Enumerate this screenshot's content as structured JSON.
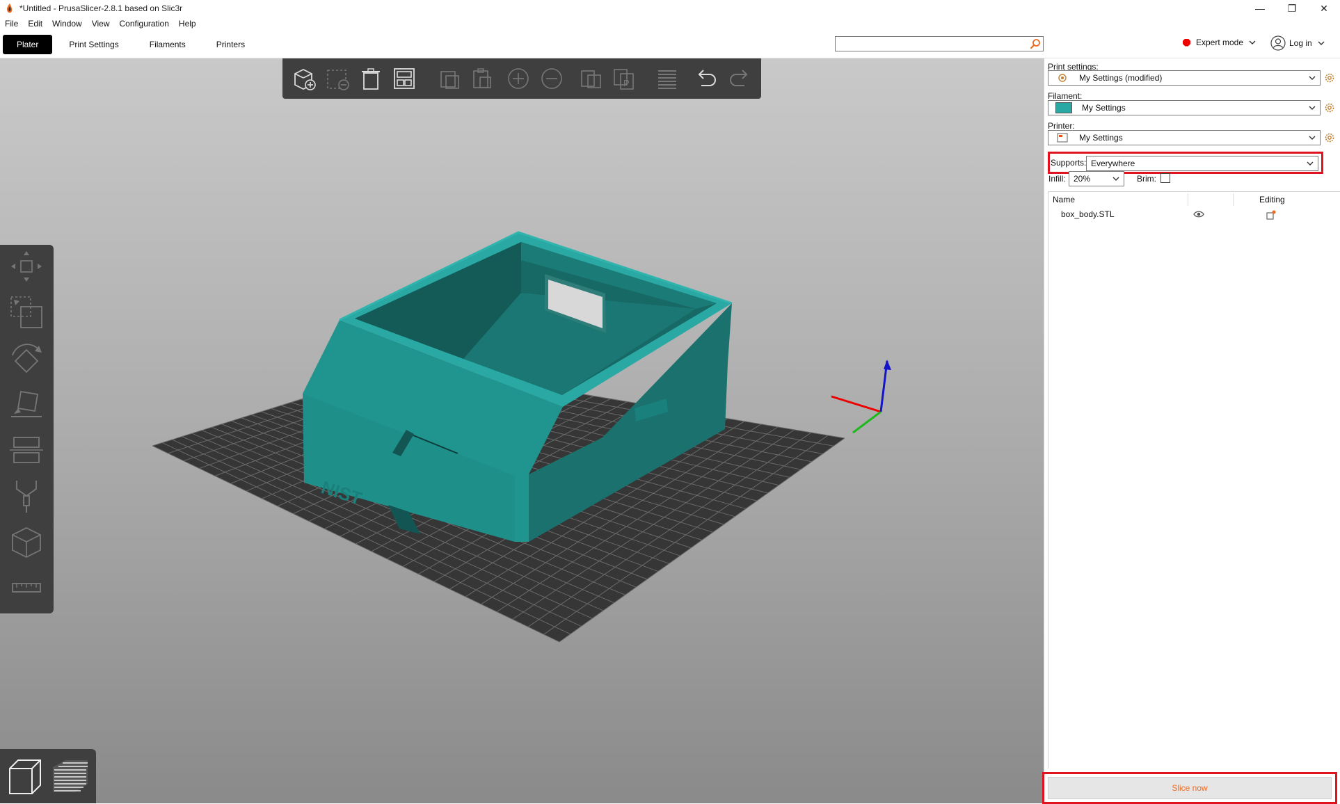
{
  "window": {
    "title": "*Untitled - PrusaSlicer-2.8.1 based on Slic3r",
    "minimize": "—",
    "maximize": "❐",
    "close": "✕"
  },
  "menu": [
    "File",
    "Edit",
    "Window",
    "View",
    "Configuration",
    "Help"
  ],
  "tabs": [
    "Plater",
    "Print Settings",
    "Filaments",
    "Printers"
  ],
  "active_tab": "Plater",
  "search": {
    "value": "",
    "placeholder": ""
  },
  "mode": {
    "label": "Expert mode",
    "color": "#e00000"
  },
  "login": {
    "label": "Log in"
  },
  "sidebar": {
    "print_settings_label": "Print settings:",
    "print_settings_value": "My Settings (modified)",
    "filament_label": "Filament:",
    "filament_value": "My Settings",
    "filament_color": "#2aa9a4",
    "printer_label": "Printer:",
    "printer_value": "My Settings",
    "supports_label": "Supports:",
    "supports_value": "Everywhere",
    "infill_label": "Infill:",
    "infill_value": "20%",
    "brim_label": "Brim:",
    "brim_checked": false,
    "object_list": {
      "col_name": "Name",
      "col_editing": "Editing",
      "rows": [
        {
          "name": "box_body.STL"
        }
      ]
    },
    "slice_button": "Slice now"
  },
  "colors": {
    "accent": "#ed6b21",
    "highlight": "#e0141e",
    "model": "#1f8f8a",
    "bed": "#3a3a3a",
    "toolbar": "#3f3f3f"
  },
  "scene": {
    "model_label": "NIST"
  }
}
